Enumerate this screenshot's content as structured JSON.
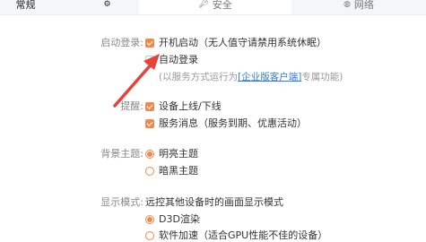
{
  "tabs": [
    {
      "label": "常规",
      "icon": "gear-icon"
    },
    {
      "label": "安全",
      "icon": "key-icon"
    },
    {
      "label": "网络",
      "icon": "globe-icon"
    }
  ],
  "startup": {
    "label": "启动登录:",
    "boot": "开机启动（无人值守请禁用系统休眠）",
    "autologin": "自动登录",
    "note_prefix": "(以服务方式运行为",
    "note_link": "[企业版客户端]",
    "note_suffix": "专属功能)"
  },
  "remind": {
    "label": "提醒:",
    "device": "设备上线/下线",
    "service": "服务消息（服务到期、优惠活动）"
  },
  "theme": {
    "label": "背景主题:",
    "light": "明亮主题",
    "dark": "暗黑主题"
  },
  "display": {
    "label": "显示模式:",
    "desc": "远控其他设备时的画面显示模式",
    "d3d": "D3D渲染",
    "soft": "软件加速（适合GPU性能不佳的设备）"
  },
  "colors": {
    "accent": "#f08a4b",
    "arrow": "#e8403a",
    "link": "#2f7dd8"
  }
}
